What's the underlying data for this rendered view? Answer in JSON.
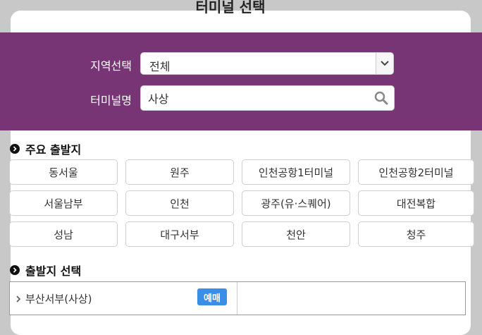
{
  "modal": {
    "title": "터미널 선택"
  },
  "search": {
    "region_label": "지역선택",
    "region_value": "전체",
    "terminal_label": "터미널명",
    "terminal_value": "사상"
  },
  "major_departures": {
    "heading": "주요 출발지",
    "items": [
      "동서울",
      "원주",
      "인천공항1터미널",
      "인천공항2터미널",
      "서울남부",
      "인천",
      "광주(유·스퀘어)",
      "대전복합",
      "성남",
      "대구서부",
      "천안",
      "청주"
    ]
  },
  "departure_select": {
    "heading": "출발지 선택",
    "results": [
      {
        "label": "부산서부(사상)",
        "badge": "예매"
      }
    ]
  },
  "colors": {
    "band": "#773576",
    "badge": "#3a8ee6"
  }
}
